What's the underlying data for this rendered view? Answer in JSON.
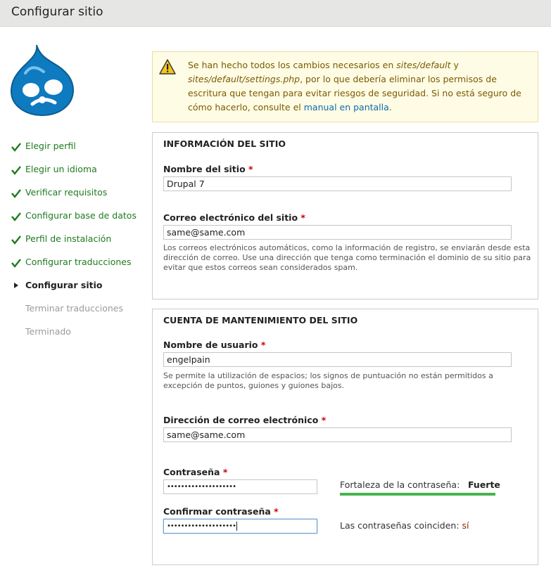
{
  "header": {
    "title": "Configurar sitio"
  },
  "steps": [
    {
      "label": "Elegir perfil",
      "state": "done"
    },
    {
      "label": "Elegir un idioma",
      "state": "done"
    },
    {
      "label": "Verificar requisitos",
      "state": "done"
    },
    {
      "label": "Configurar base de datos",
      "state": "done"
    },
    {
      "label": "Perfil de instalación",
      "state": "done"
    },
    {
      "label": "Configurar traducciones",
      "state": "done"
    },
    {
      "label": "Configurar sitio",
      "state": "active"
    },
    {
      "label": "Terminar traducciones",
      "state": "pending"
    },
    {
      "label": "Terminado",
      "state": "pending"
    }
  ],
  "warning": {
    "text_1": "Se han hecho todos los cambios necesarios en ",
    "path_1": "sites/default",
    "text_2": " y ",
    "path_2": "sites/default/settings.php",
    "text_3": ", por lo que debería eliminar los permisos de escritura que tengan para evitar riesgos de seguridad. Si no está seguro de cómo hacerlo, consulte el ",
    "link": "manual en pantalla",
    "text_4": "."
  },
  "site_info": {
    "legend": "INFORMACIÓN DEL SITIO",
    "name_label": "Nombre del sitio",
    "name_value": "Drupal 7",
    "email_label": "Correo electrónico del sitio",
    "email_value": "same@same.com",
    "email_desc": "Los correos electrónicos automáticos, como la información de registro, se enviarán desde esta dirección de correo. Use una dirección que tenga como terminación el dominio de su sitio para evitar que estos correos sean considerados spam."
  },
  "account": {
    "legend": "CUENTA DE MANTENIMIENTO DEL SITIO",
    "username_label": "Nombre de usuario",
    "username_value": "engelpain",
    "username_desc": "Se permite la utilización de espacios; los signos de puntuación no están permitidos a excepción de puntos, guiones y guiones bajos.",
    "email_label": "Dirección de correo electrónico",
    "email_value": "same@same.com",
    "password_label": "Contraseña",
    "password_value": "••••••••••••••••••••",
    "strength_label": "Fortaleza de la contraseña:",
    "strength_value": "Fuerte",
    "strength_level": 1.0,
    "confirm_label": "Confirmar contraseña",
    "confirm_value": "••••••••••••••••••••",
    "match_label": "Las contraseñas coinciden:",
    "match_value": "sí"
  },
  "required_mark": "*",
  "colors": {
    "done": "#1f7a1f",
    "strength_bar": "#47b34d",
    "required": "#cc0000",
    "link": "#0b6ab0"
  }
}
